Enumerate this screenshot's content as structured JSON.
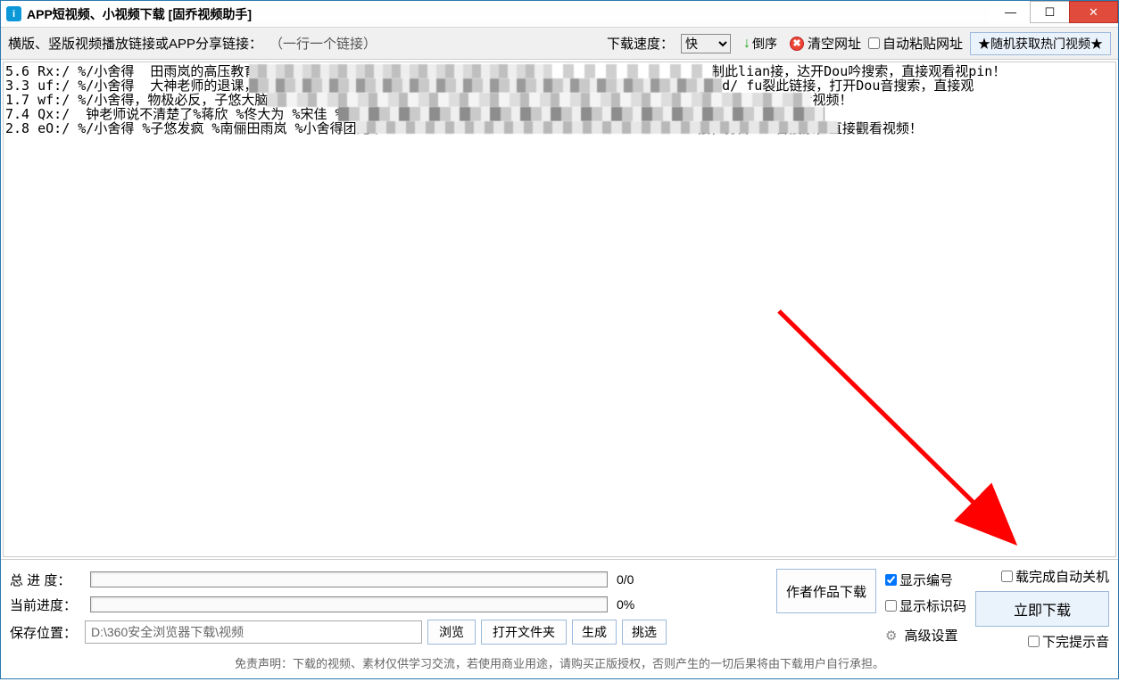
{
  "titlebar": {
    "icon_letter": "i",
    "title": "APP短视频、小视频下载 [固乔视频助手]"
  },
  "toolbar": {
    "link_label": "横版、竖版视频播放链接或APP分享链接：",
    "hint": "（一行一个链接）",
    "speed_label": "下载速度：",
    "speed_value": "快",
    "reverse": "倒序",
    "clear": "清空网址",
    "auto_paste": "自动粘贴网址",
    "random_btn": "★随机获取热门视频★"
  },
  "urls": "5.6 Rx:/ %/小舍得  田雨岚的高压教育，                                                   / 复制此lian接，达开Dou吟搜索，直接观看视pin！\n3.3 uf:/ %/小舍得  大神老师的退课，成                                                 /eSMgL8d/ fu裂此链接，打开Dou音搜索，直接观\n1.7 wf:/ %/小舍得，物极必反，子悠大脑出现问题，田雨岚的发泄                                    音搜索，直接观看视频！\n7.4 Qx:/  钟老师说不清楚了%蒋欣 %佟大为 %宋佳 %子悠发疯                                        \n2.8 eO:/ %/小舍得 %子悠发疯 %南俪田雨岚 %小舍得团宠单                                       接，打开Dou音搜索，直接觀看视频！",
  "progress": {
    "total_label": "总 进 度：",
    "total_stat": "0/0",
    "current_label": "当前进度：",
    "current_stat": "0%"
  },
  "buttons": {
    "author": "作者作品下载",
    "browse": "浏览",
    "open_folder": "打开文件夹",
    "generate": "生成",
    "pick": "挑选",
    "advanced": "高级设置",
    "download_now": "立即下载"
  },
  "checks": {
    "show_index": "显示编号",
    "show_id": "显示标识码",
    "shutdown": "载完成自动关机",
    "sound": "下完提示音"
  },
  "save": {
    "label": "保存位置：",
    "path": "D:\\360安全浏览器下载\\视频"
  },
  "disclaimer": "免责声明：下载的视频、素材仅供学习交流，若使用商业用途，请购买正版授权，否则产生的一切后果将由下载用户自行承担。"
}
